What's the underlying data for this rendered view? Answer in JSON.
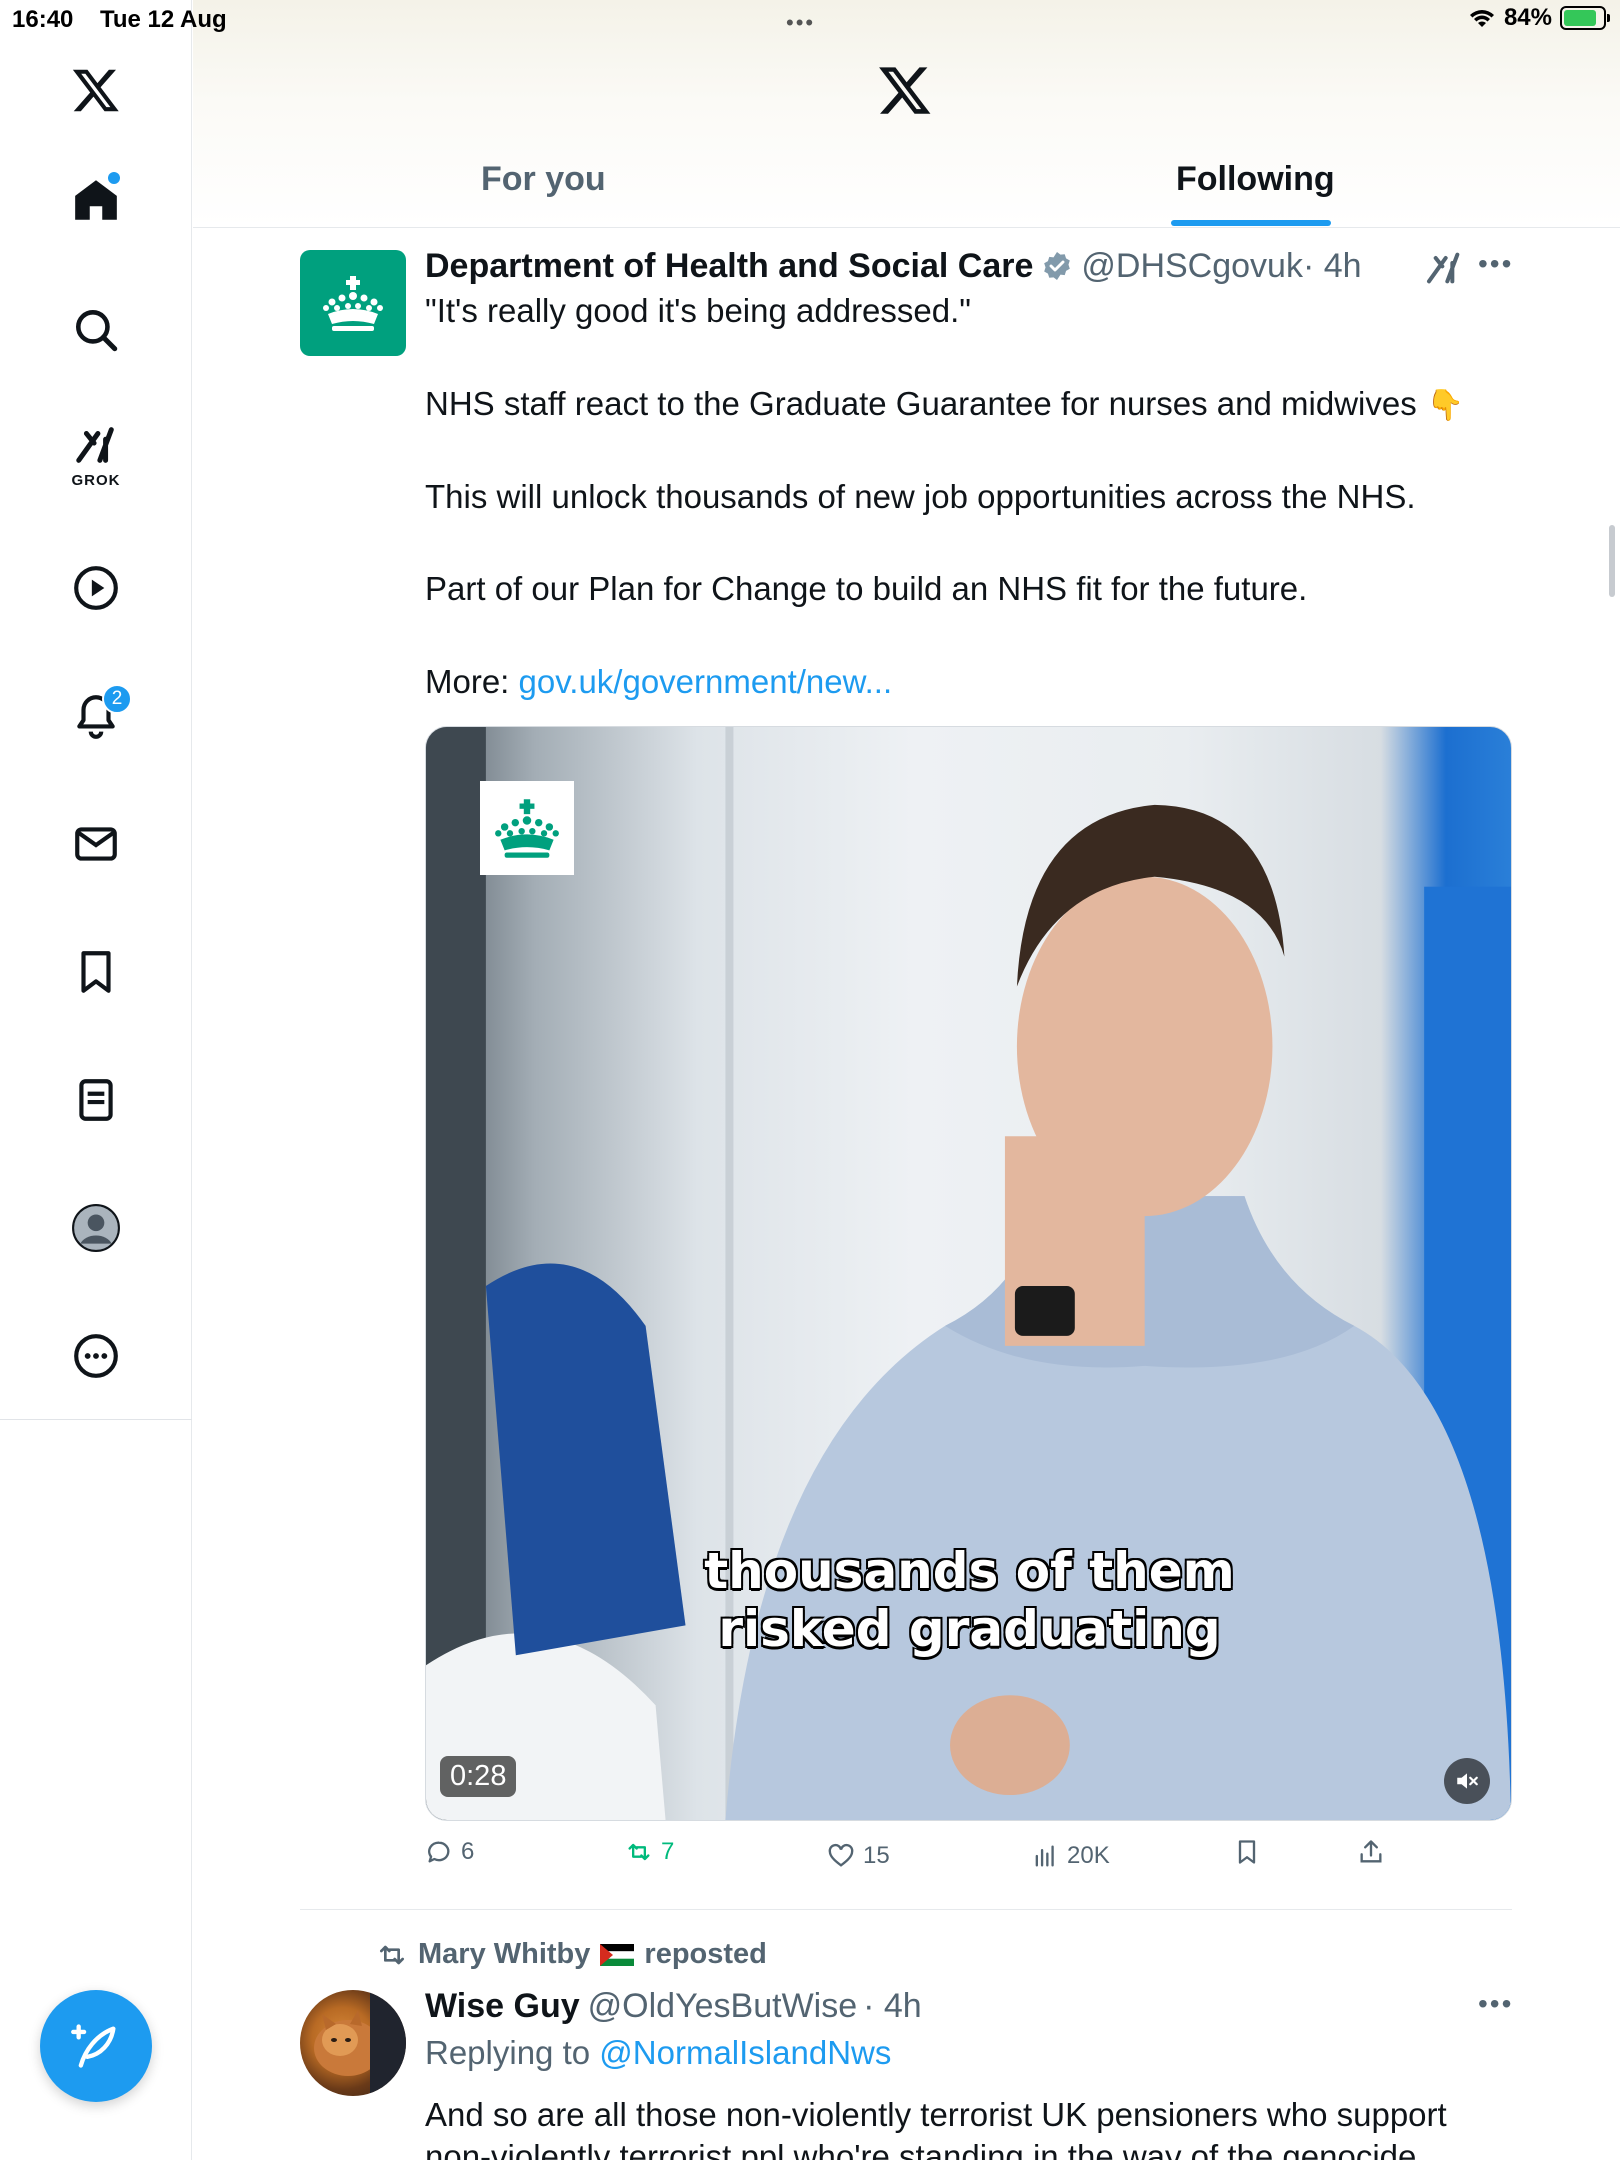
{
  "status_bar": {
    "time": "16:40",
    "date": "Tue 12 Aug",
    "battery": "84%",
    "battery_level": 0.84
  },
  "sidebar": {
    "grok_label": "GROK",
    "notifications_count": "2",
    "items": [
      "x-logo",
      "home-icon",
      "search-icon",
      "grok-icon",
      "video-icon",
      "notifications-icon",
      "messages-icon",
      "bookmarks-icon",
      "lists-icon",
      "profile-icon",
      "more-icon"
    ]
  },
  "header": {
    "tabs": [
      {
        "label": "For you",
        "active": false
      },
      {
        "label": "Following",
        "active": true
      }
    ]
  },
  "post": {
    "author_name": "Department of Health and Social Care",
    "handle": "@DHSCgovuk",
    "time": "· 4h",
    "lines": [
      "\"It's really good it's being addressed.\"",
      "NHS staff react to the Graduate Guarantee for nurses and midwives",
      "This will unlock thousands of new job opportunities across the NHS.",
      "Part of our Plan for Change to build an NHS fit for the future."
    ],
    "emoji": "👇",
    "more_label": "More:",
    "link": "gov.uk/government/new...",
    "video": {
      "caption_line1": "thousands of them",
      "caption_line2": "risked graduating",
      "duration": "0:28"
    },
    "stats": {
      "replies": "6",
      "reposts": "7",
      "likes": "15",
      "views": "20K"
    }
  },
  "post2": {
    "reposted_by": "Mary Whitby",
    "reposted_label": "reposted",
    "author_name": "Wise Guy",
    "handle": "@OldYesButWise",
    "time": "· 4h",
    "replying_label": "Replying to",
    "replying_to": "@NormalIslandNws",
    "text_line1": "And so are all those non-violently terrorist UK pensioners who support",
    "text_line2": "non-violently terrorist ppl who're standing in the way of the genocide"
  },
  "colors": {
    "accent": "#1d9bf0",
    "repost_green": "#00ba7c",
    "dhsc_green": "#00a07e",
    "secondary_text": "#536471"
  }
}
